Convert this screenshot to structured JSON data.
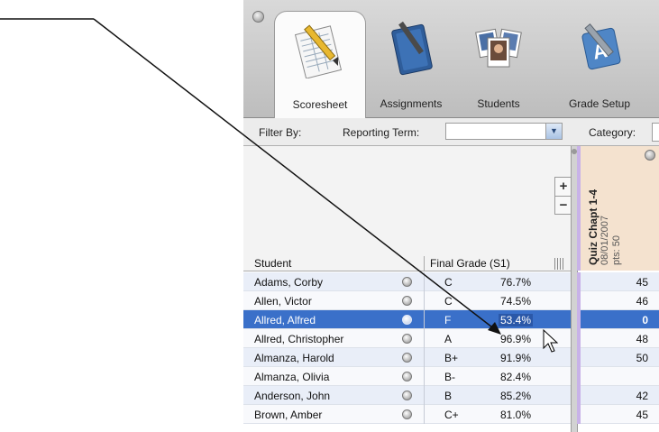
{
  "toolbar": {
    "tabs": [
      {
        "label": "Scoresheet",
        "icon": "scoresheet-icon",
        "active": true
      },
      {
        "label": "Assignments",
        "icon": "assignments-icon",
        "active": false
      },
      {
        "label": "Students",
        "icon": "students-icon",
        "active": false
      },
      {
        "label": "Grade Setup",
        "icon": "grade-setup-icon",
        "active": false
      }
    ]
  },
  "filter": {
    "filter_by_label": "Filter By:",
    "reporting_term_label": "Reporting Term:",
    "reporting_term_value": "",
    "category_label": "Category:"
  },
  "zoom": {
    "plus": "+",
    "minus": "−"
  },
  "grid": {
    "student_header": "Student",
    "final_grade_header": "Final Grade (S1)",
    "assignment": {
      "title": "Quiz Chapt 1-4",
      "date": "08/01/2007",
      "points": "pts: 50"
    },
    "rows": [
      {
        "name": "Adams, Corby",
        "letter": "C",
        "percent": "76.7%",
        "score": "45"
      },
      {
        "name": "Allen, Victor",
        "letter": "C",
        "percent": "74.5%",
        "score": "46"
      },
      {
        "name": "Allred, Alfred",
        "letter": "F",
        "percent": "53.4%",
        "score": "0"
      },
      {
        "name": "Allred, Christopher",
        "letter": "A",
        "percent": "96.9%",
        "score": "48"
      },
      {
        "name": "Almanza, Harold",
        "letter": "B+",
        "percent": "91.9%",
        "score": "50"
      },
      {
        "name": "Almanza, Olivia",
        "letter": "B-",
        "percent": "82.4%",
        "score": ""
      },
      {
        "name": "Anderson, John",
        "letter": "B",
        "percent": "85.2%",
        "score": "42"
      },
      {
        "name": "Brown, Amber",
        "letter": "C+",
        "percent": "81.0%",
        "score": "45"
      }
    ],
    "selected_row": 2
  },
  "colors": {
    "selection": "#3a70c9",
    "row_alt": "#e9eef8",
    "assignment_header": "#f4e2cf",
    "assignment_accent": "#c8b2e8"
  }
}
